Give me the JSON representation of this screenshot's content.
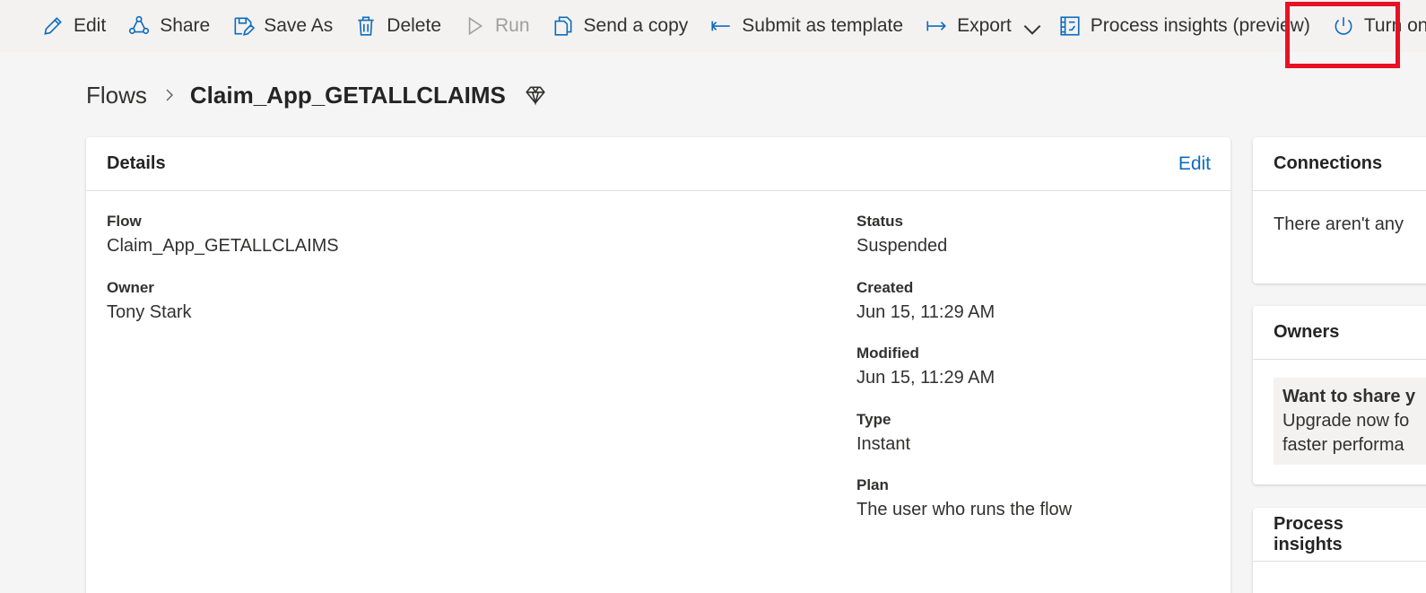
{
  "toolbar": {
    "items": [
      {
        "label": "Edit",
        "icon": "pencil-icon"
      },
      {
        "label": "Share",
        "icon": "share-icon"
      },
      {
        "label": "Save As",
        "icon": "save-as-icon"
      },
      {
        "label": "Delete",
        "icon": "trash-icon"
      },
      {
        "label": "Run",
        "icon": "play-icon",
        "disabled": true
      },
      {
        "label": "Send a copy",
        "icon": "copy-icon"
      },
      {
        "label": "Submit as template",
        "icon": "arrow-left-icon"
      },
      {
        "label": "Export",
        "icon": "arrow-right-icon"
      },
      {
        "label": "Process insights (preview)",
        "icon": "process-insights-icon"
      },
      {
        "label": "Turn on",
        "icon": "power-icon"
      }
    ],
    "highlight_color": "#e81123"
  },
  "breadcrumb": {
    "root": "Flows",
    "current": "Claim_App_GETALLCLAIMS"
  },
  "details": {
    "title": "Details",
    "edit_label": "Edit",
    "flow_label": "Flow",
    "flow_value": "Claim_App_GETALLCLAIMS",
    "owner_label": "Owner",
    "owner_value": "Tony Stark",
    "status_label": "Status",
    "status_value": "Suspended",
    "created_label": "Created",
    "created_value": "Jun 15, 11:29 AM",
    "modified_label": "Modified",
    "modified_value": "Jun 15, 11:29 AM",
    "type_label": "Type",
    "type_value": "Instant",
    "plan_label": "Plan",
    "plan_value": "The user who runs the flow"
  },
  "connections": {
    "title": "Connections",
    "body": "There aren't any"
  },
  "owners": {
    "title": "Owners",
    "upsell_title": "Want to share y",
    "upsell_line1": "Upgrade now fo",
    "upsell_line2": "faster performa"
  },
  "process_insights": {
    "title": "Process insights"
  },
  "colors": {
    "accent": "#0f6cbd",
    "background": "#f5f5f5",
    "toolbar": "#f3f2f1"
  }
}
